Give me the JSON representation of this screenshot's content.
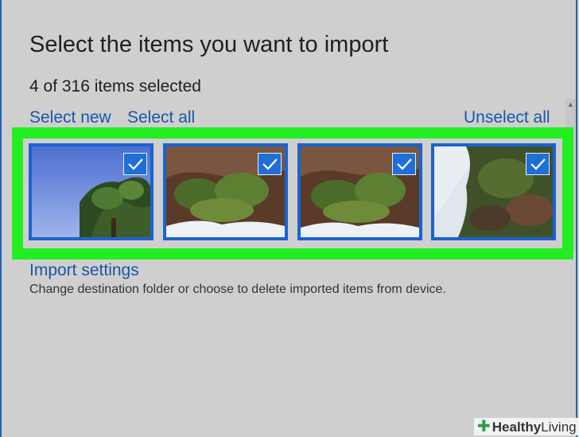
{
  "dialog": {
    "title": "Select the items you want to import",
    "selection_count": "4 of 316 items selected",
    "select_new": "Select new",
    "select_all": "Select all",
    "unselect_all": "Unselect all",
    "import_settings_link": "Import settings",
    "import_settings_desc": "Change destination folder or choose to delete imported items from device."
  },
  "thumbnails": [
    {
      "label": "photo-1",
      "selected": true
    },
    {
      "label": "photo-2",
      "selected": true
    },
    {
      "label": "photo-3",
      "selected": true
    },
    {
      "label": "photo-4",
      "selected": true
    }
  ],
  "colors": {
    "highlight": "#22ee22",
    "link": "#1a56a8",
    "selection_border": "#1b63d0",
    "check_fill": "#1f6fd6"
  },
  "watermark": {
    "brand_bold": "Healthy",
    "brand_light": "Living"
  }
}
